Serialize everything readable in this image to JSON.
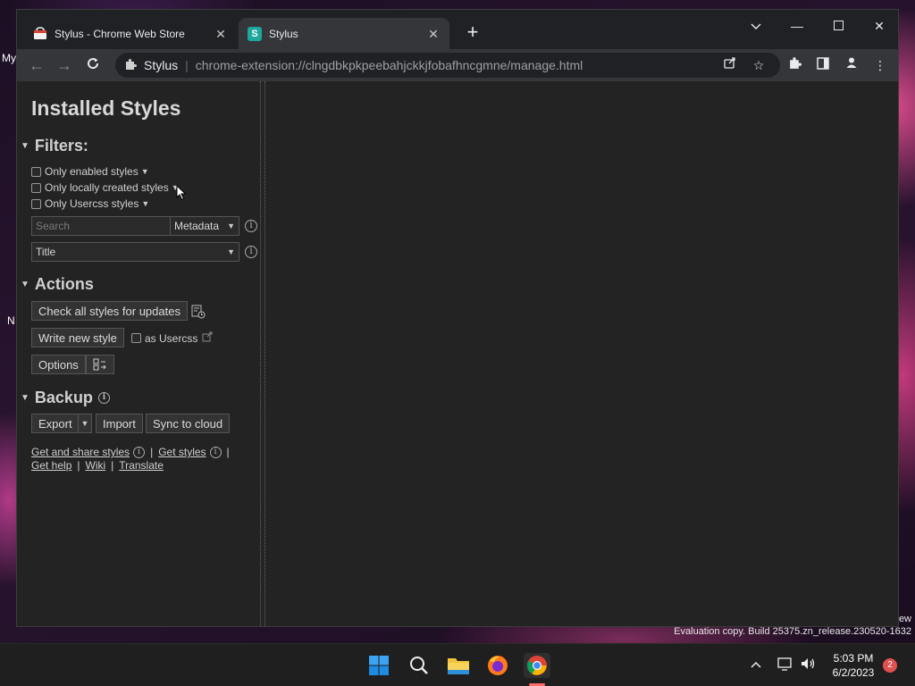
{
  "desktop": {
    "labels": [
      "My",
      "N"
    ],
    "watermark_top": "ew",
    "watermark": "Evaluation copy. Build 25375.zn_release.230520-1632"
  },
  "browser": {
    "tabs": [
      {
        "title": "Stylus - Chrome Web Store",
        "favicon": "chrome-web-store-icon",
        "active": false
      },
      {
        "title": "Stylus",
        "favicon": "stylus-icon",
        "active": true
      }
    ],
    "address": {
      "site": "Stylus",
      "url": "chrome-extension://clngdbkpkpeebahjckkjfobafhncgmne/manage.html"
    }
  },
  "manager": {
    "title": "Installed Styles",
    "filters": {
      "heading": "Filters:",
      "enabled": "Only enabled styles",
      "local": "Only locally created styles",
      "usercss": "Only Usercss styles",
      "search_placeholder": "Search",
      "search_mode": "Metadata",
      "sort": "Title"
    },
    "actions": {
      "heading": "Actions",
      "check_updates": "Check all styles for updates",
      "write_new": "Write new style",
      "as_usercss": "as Usercss",
      "options": "Options"
    },
    "backup": {
      "heading": "Backup",
      "export": "Export",
      "import": "Import",
      "sync": "Sync to cloud"
    },
    "links": {
      "get_share": "Get and share styles",
      "get_styles": "Get styles",
      "help": "Get help",
      "wiki": "Wiki",
      "translate": "Translate"
    }
  },
  "taskbar": {
    "time": "5:03 PM",
    "date": "6/2/2023",
    "notifications": "2"
  }
}
